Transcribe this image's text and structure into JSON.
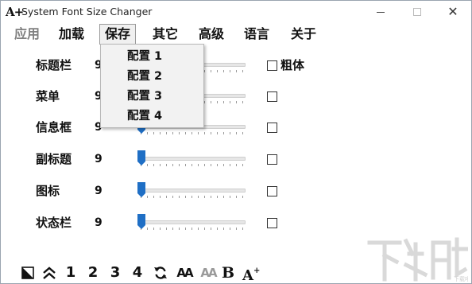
{
  "window": {
    "title": "System Font Size Changer",
    "icon_glyph": "A+"
  },
  "menubar": {
    "items": [
      {
        "label": "应用",
        "state": "disabled"
      },
      {
        "label": "加载",
        "state": "normal"
      },
      {
        "label": "保存",
        "state": "open"
      },
      {
        "label": "其它",
        "state": "normal"
      },
      {
        "label": "高级",
        "state": "normal"
      },
      {
        "label": "语言",
        "state": "normal"
      },
      {
        "label": "关于",
        "state": "normal"
      }
    ]
  },
  "dropdown": {
    "items": [
      "配置 1",
      "配置 2",
      "配置 3",
      "配置 4"
    ]
  },
  "settings": {
    "rows": [
      {
        "label": "标题栏",
        "value": "9",
        "bold_checked": false
      },
      {
        "label": "菜单",
        "value": "9",
        "bold_checked": false
      },
      {
        "label": "信息框",
        "value": "9",
        "bold_checked": false
      },
      {
        "label": "副标题",
        "value": "9",
        "bold_checked": false
      },
      {
        "label": "图标",
        "value": "9",
        "bold_checked": false
      },
      {
        "label": "状态栏",
        "value": "9",
        "bold_checked": false
      }
    ],
    "bold_label": "粗体"
  },
  "toolbar": {
    "btn_1": "1",
    "btn_2": "2",
    "btn_3": "3",
    "btn_4": "4",
    "font_aa": "AA",
    "font_aa_grey": "AA",
    "bold_b": "B",
    "font_plus": "A"
  },
  "watermark": {
    "text": "下载吧"
  },
  "colors": {
    "slider_thumb": "#1f6fc5",
    "disabled_menu": "#808080",
    "dropdown_bg": "#f2f2f2"
  },
  "icons": {
    "app": "font-size-icon",
    "minimize": "minimize-icon",
    "maximize": "maximize-icon",
    "close": "close-icon",
    "contrast": "contrast-icon",
    "collapse": "double-chevron-up-icon",
    "refresh": "refresh-icon"
  }
}
